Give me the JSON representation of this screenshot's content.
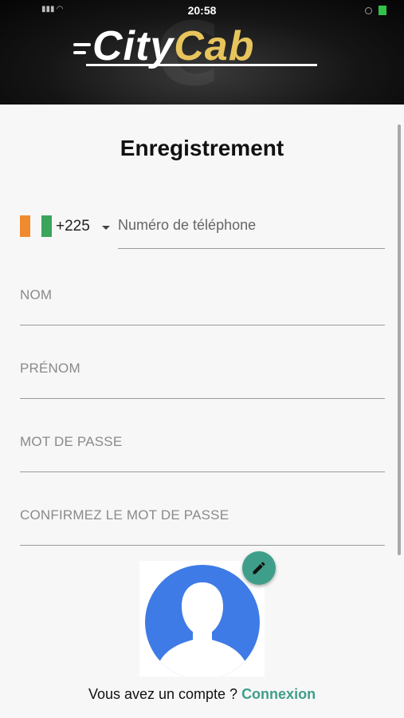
{
  "status_bar": {
    "time": "20:58"
  },
  "brand": {
    "city": "City",
    "cab": "Cab",
    "accent_color": "#e7c45c"
  },
  "page": {
    "title": "Enregistrement"
  },
  "phone": {
    "flag": "cote-divoire-flag",
    "dial_code": "+225",
    "placeholder": "Numéro de téléphone"
  },
  "fields": {
    "nom": "NOM",
    "prenom": "PRÉNOM",
    "mot_de_passe": "MOT DE PASSE",
    "confirm_mot_de_passe": "CONFIRMEZ LE MOT DE PASSE"
  },
  "avatar": {
    "icon": "user-placeholder",
    "edit_icon": "pencil-icon",
    "color": "#3f7be6"
  },
  "footer": {
    "prompt": "Vous avez un compte ? ",
    "link": "Connexion",
    "link_color": "#3f9e8a"
  }
}
